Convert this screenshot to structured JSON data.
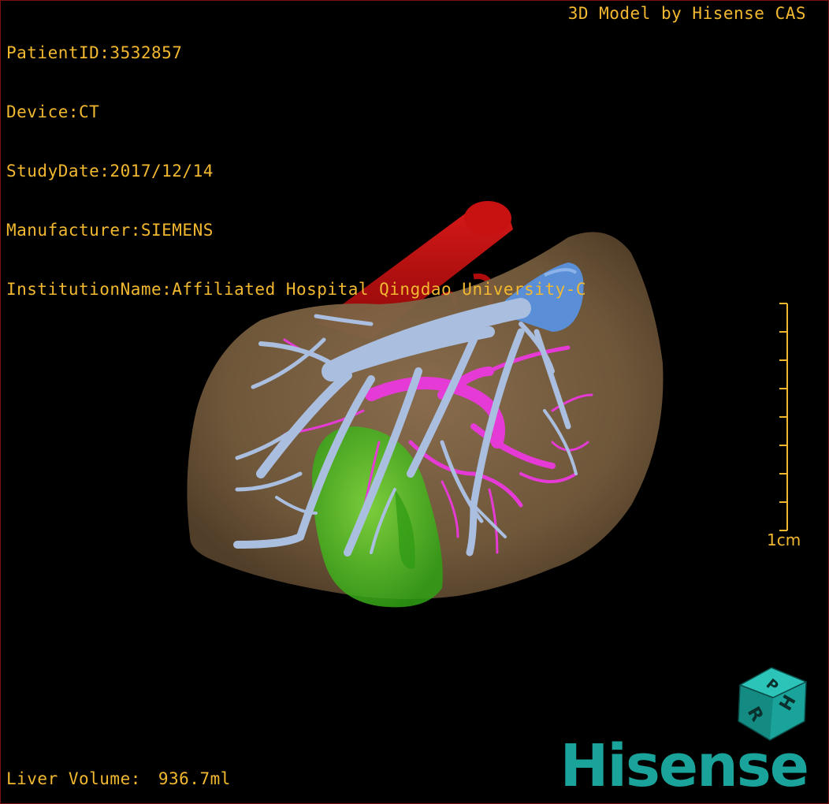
{
  "patient_info": {
    "patient_id": "PatientID:3532857",
    "device": "Device:CT",
    "study_date": "StudyDate:2017/12/14",
    "manufacturer": "Manufacturer:SIEMENS",
    "institution": "InstitutionName:Affiliated Hospital Qingdao University-C"
  },
  "credit": "3D Model by Hisense CAS",
  "volume": {
    "label": "Liver Volume:",
    "value": "936.7ml"
  },
  "scale": {
    "label": "1cm",
    "tick_count": 9
  },
  "orientation_cube": {
    "faces": [
      "P",
      "H",
      "R"
    ]
  },
  "brand": "Hisense",
  "colors": {
    "hud_text": "#f2b830",
    "liver": "#7a5e3e",
    "aorta": "#b80c0c",
    "portal_vein": "#aabfe0",
    "hepatic_artery": "#e63ad6",
    "gallbladder": "#46c41c",
    "ivc": "#5a8fd8",
    "brand": "#1aa39a"
  }
}
